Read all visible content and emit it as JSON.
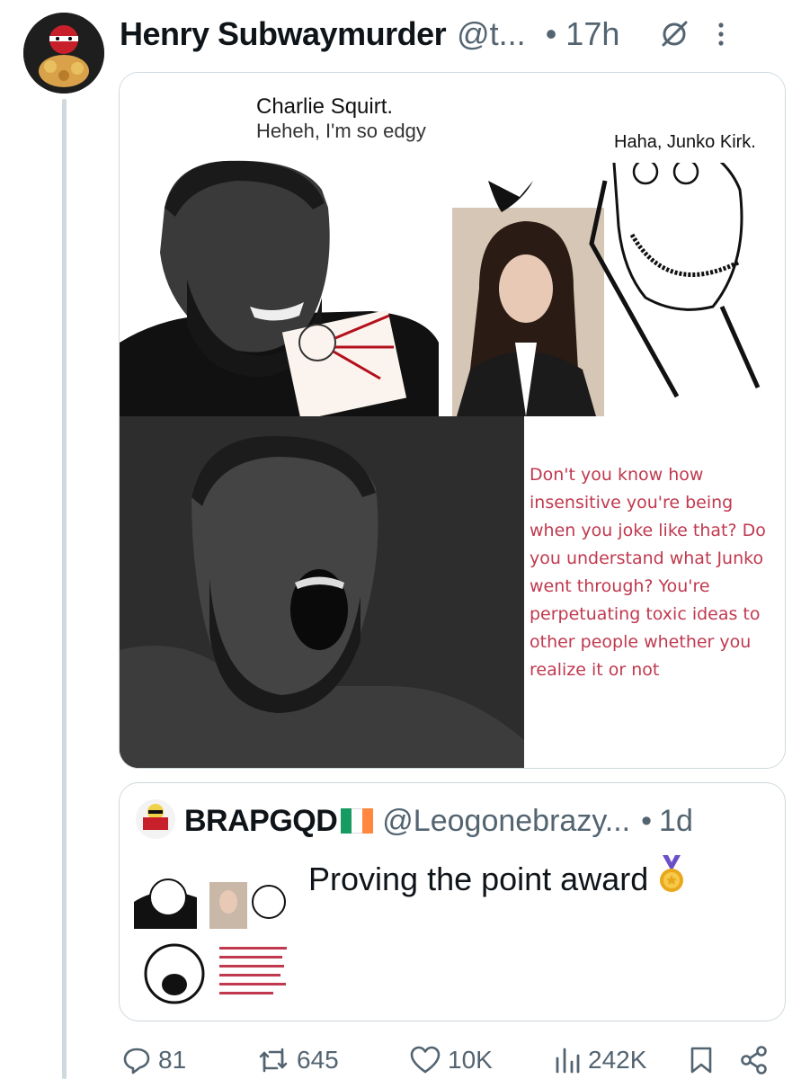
{
  "tweet": {
    "display_name": "Henry Subwaymurder",
    "handle": "@t...",
    "separator": "•",
    "time": "17h",
    "grok_icon": "grok-slash-icon",
    "more_icon": "more-dots-icon"
  },
  "meme": {
    "top_left_name": "Charlie Squirt.",
    "top_left_line": "Heheh, I'm so edgy",
    "top_right_caption": "Haha, Junko Kirk.",
    "speech": "Don't you know how insensitive you're being when you joke like that? Do you understand what  Junko went through? You're perpetuating toxic ideas to other people whether you realize it or not"
  },
  "quote": {
    "display_name": "BRAPGQD",
    "flag_colors": [
      "#169b62",
      "#ffffff",
      "#ff883e"
    ],
    "handle": "@Leogonebrazy...",
    "separator": "•",
    "time": "1d",
    "text": "Proving the point award",
    "emoji_icon": "medal-icon"
  },
  "actions": {
    "replies": "81",
    "reposts": "645",
    "likes": "10K",
    "views": "242K"
  },
  "colors": {
    "text": "#0f1419",
    "muted": "#536471",
    "border": "#cfd9de",
    "speech_red": "#c0394f"
  }
}
